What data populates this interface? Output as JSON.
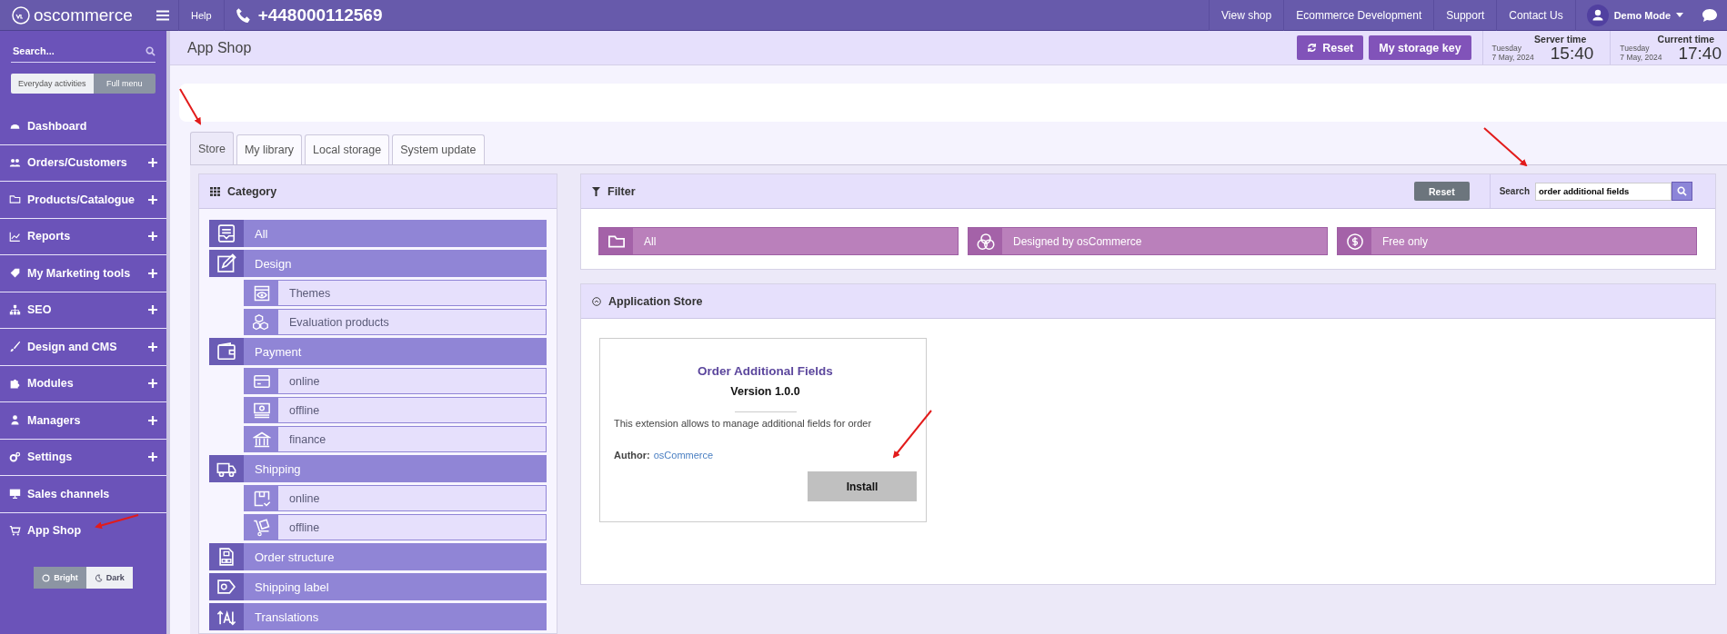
{
  "topbar": {
    "logo": "oscommerce",
    "help": "Help",
    "phone": "+448000112569",
    "links": [
      "View shop",
      "Ecommerce Development",
      "Support",
      "Contact Us"
    ],
    "user": "Demo Mode"
  },
  "sidebar": {
    "search_placeholder": "Search...",
    "modes": [
      {
        "label": "Everyday activities",
        "selected": false
      },
      {
        "label": "Full menu",
        "selected": true
      }
    ],
    "items": [
      {
        "label": "Dashboard",
        "expandable": false
      },
      {
        "label": "Orders/Customers",
        "expandable": true
      },
      {
        "label": "Products/Catalogue",
        "expandable": true
      },
      {
        "label": "Reports",
        "expandable": true
      },
      {
        "label": "My Marketing tools",
        "expandable": true
      },
      {
        "label": "SEO",
        "expandable": true
      },
      {
        "label": "Design and CMS",
        "expandable": true
      },
      {
        "label": "Modules",
        "expandable": true
      },
      {
        "label": "Managers",
        "expandable": true
      },
      {
        "label": "Settings",
        "expandable": true
      },
      {
        "label": "Sales channels",
        "expandable": false
      },
      {
        "label": "App Shop",
        "expandable": false
      }
    ],
    "themes": [
      {
        "label": "Bright",
        "selected": true
      },
      {
        "label": "Dark",
        "selected": false
      }
    ]
  },
  "header": {
    "title": "App Shop",
    "buttons": [
      "Reset",
      "My storage key"
    ],
    "clocks": [
      {
        "label": "Server time",
        "day": "Tuesday",
        "date": "7 May, 2024",
        "time": "15:40"
      },
      {
        "label": "Current time",
        "day": "Tuesday",
        "date": "7 May, 2024",
        "time": "17:40"
      }
    ]
  },
  "tabs": [
    {
      "label": "Store",
      "selected": true
    },
    {
      "label": "My library",
      "selected": false
    },
    {
      "label": "Local storage",
      "selected": false
    },
    {
      "label": "System update",
      "selected": false
    }
  ],
  "category": {
    "title": "Category",
    "items": [
      {
        "label": "All"
      },
      {
        "label": "Design",
        "children": [
          {
            "label": "Themes"
          },
          {
            "label": "Evaluation products"
          }
        ]
      },
      {
        "label": "Payment",
        "children": [
          {
            "label": "online"
          },
          {
            "label": "offline"
          },
          {
            "label": "finance"
          }
        ]
      },
      {
        "label": "Shipping",
        "children": [
          {
            "label": "online"
          },
          {
            "label": "offline"
          }
        ]
      },
      {
        "label": "Order structure"
      },
      {
        "label": "Shipping label"
      },
      {
        "label": "Translations"
      }
    ]
  },
  "filter": {
    "title": "Filter",
    "reset": "Reset",
    "search_label": "Search",
    "search_value": "order additional fields",
    "options": [
      {
        "label": "All"
      },
      {
        "label": "Designed by osCommerce"
      },
      {
        "label": "Free only"
      }
    ]
  },
  "store": {
    "title": "Application Store",
    "apps": [
      {
        "name": "Order Additional Fields",
        "version": "Version 1.0.0",
        "description": "This extension allows to manage additional fields for order",
        "author_label": "Author:",
        "author": "osCommerce",
        "button": "Install"
      }
    ]
  }
}
